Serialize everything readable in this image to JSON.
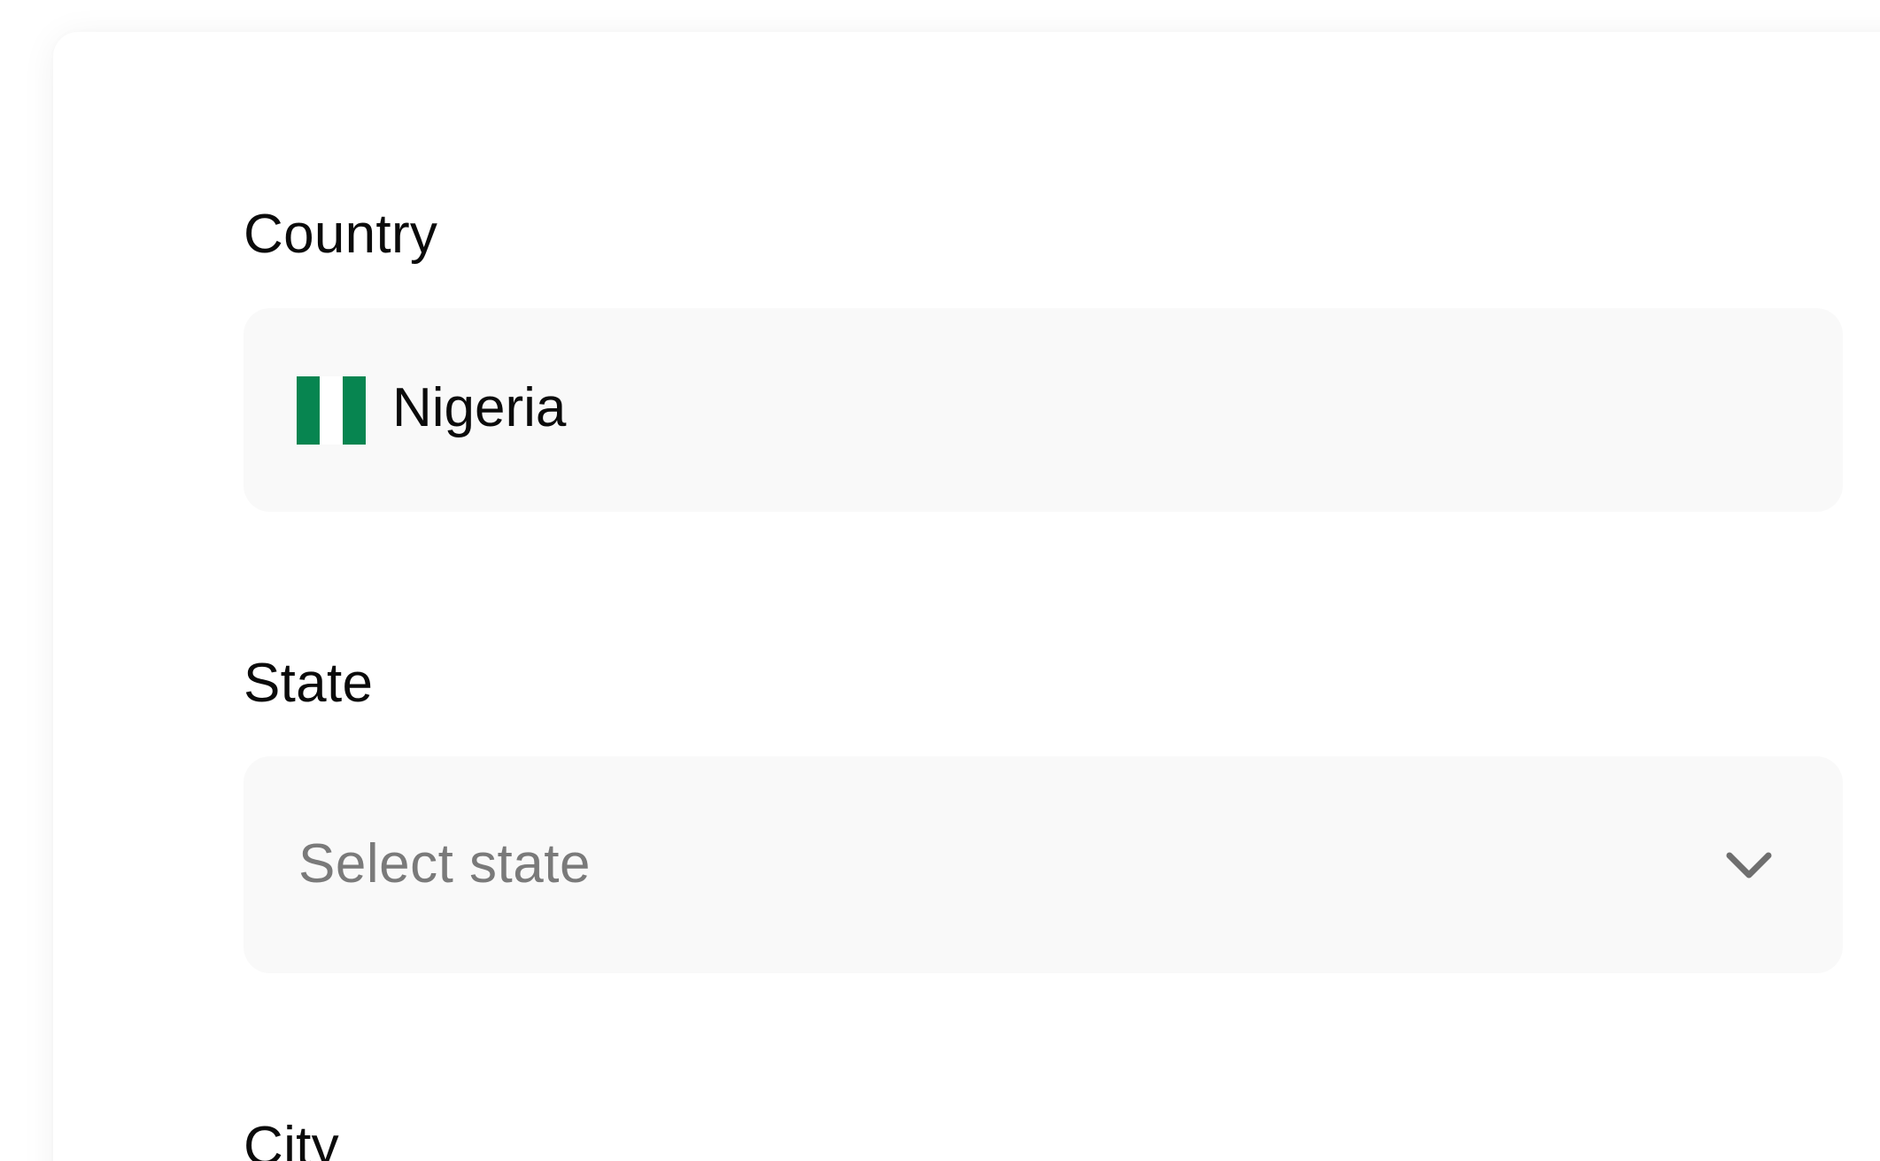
{
  "form": {
    "country": {
      "label": "Country",
      "value": "Nigeria",
      "flag_icon": "nigeria-flag-icon",
      "flag_colors": [
        "#078550",
        "#ffffff",
        "#078550"
      ]
    },
    "state": {
      "label": "State",
      "placeholder": "Select state",
      "icon": "chevron-down-icon"
    },
    "city": {
      "label": "City"
    }
  },
  "colors": {
    "field_background": "#f9f9f9",
    "label_text": "#0b0b0b",
    "placeholder_text": "#7a7a7a",
    "chevron": "#6f6f6f"
  }
}
